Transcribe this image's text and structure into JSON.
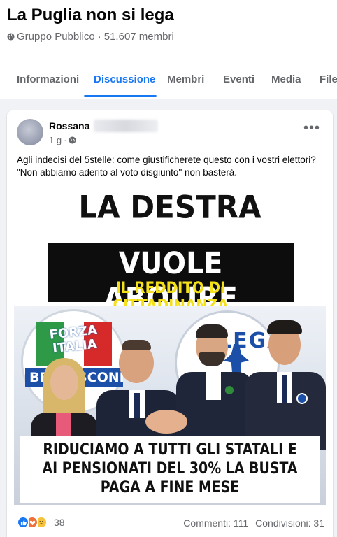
{
  "group": {
    "title": "La Puglia non si lega",
    "privacy": "Gruppo Pubblico",
    "separator": "·",
    "members": "51.607 membri"
  },
  "tabs": [
    {
      "label": "Informazioni",
      "active": false
    },
    {
      "label": "Discussione",
      "active": true
    },
    {
      "label": "Membri",
      "active": false
    },
    {
      "label": "Eventi",
      "active": false
    },
    {
      "label": "Media",
      "active": false
    },
    {
      "label": "File",
      "active": false
    }
  ],
  "post": {
    "author": "Rossana",
    "time": "1 g",
    "time_separator": "·",
    "privacy_icon": "globe-icon",
    "more_label": "•••",
    "text": "Agli indecisi del 5stelle: come  giustificherete questo con i vostri elettori? \"Non abbiamo aderito al voto disgiunto\" non basterà.",
    "image": {
      "headline_1": "LA DESTRA",
      "headline_2": "VUOLE ABOLIRE",
      "headline_3": "IL REDDITO DI CITTADINANZA",
      "logo_fi_text": "FORZA ITALIA",
      "logo_fi_sub": "BERLUSCONI",
      "logo_lega_text": "LEGA",
      "caption": "RIDUCIAMO A TUTTI GLI STATALI E AI PENSIONATI DEL 30% LA BUSTA PAGA A FINE MESE"
    },
    "reactions": {
      "icons": [
        "like-icon",
        "love-icon",
        "sad-icon"
      ],
      "count": "38"
    },
    "comments": "Commenti: 111",
    "shares": "Condivisioni: 31"
  },
  "colors": {
    "accent": "#1877f2",
    "secondary_text": "#65676b",
    "feed_background": "#f0f2f5",
    "banner_yellow": "#f5e11a"
  }
}
